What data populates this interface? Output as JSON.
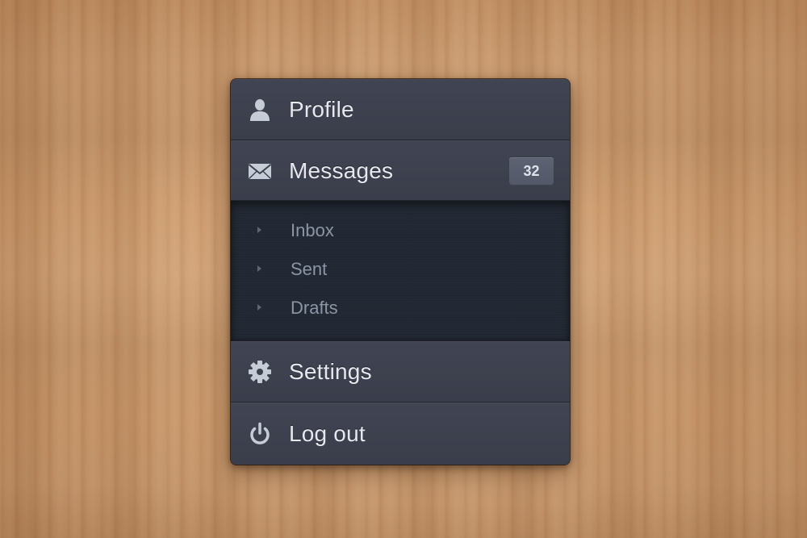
{
  "menu": {
    "items": [
      {
        "label": "Profile",
        "icon": "user-icon"
      },
      {
        "label": "Messages",
        "icon": "envelope-icon",
        "badge": "32"
      },
      {
        "label": "Settings",
        "icon": "gear-icon"
      },
      {
        "label": "Log out",
        "icon": "power-icon"
      }
    ],
    "submenu": [
      {
        "label": "Inbox",
        "icon": "caret-right-icon"
      },
      {
        "label": "Sent",
        "icon": "caret-right-icon"
      },
      {
        "label": "Drafts",
        "icon": "caret-right-icon"
      }
    ]
  },
  "colors": {
    "background": "#d9a574",
    "menu": "#3b3f4c",
    "submenu": "#222833",
    "label": "#e6e8ee",
    "sublabel": "#8a96a4",
    "badge": "#585e6e"
  }
}
